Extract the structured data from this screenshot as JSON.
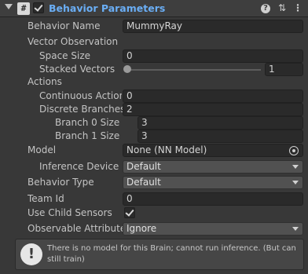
{
  "header": {
    "title": "Behavior Parameters",
    "script_glyph": "#",
    "help_glyph": "?",
    "preset_glyph": "⇅",
    "more_glyph": "⋮",
    "enabled": true
  },
  "fields": {
    "behavior_name": {
      "label": "Behavior Name",
      "value": "MummyRay"
    },
    "vector_observation": {
      "label": "Vector Observation"
    },
    "space_size": {
      "label": "Space Size",
      "value": "0"
    },
    "stacked_vectors": {
      "label": "Stacked Vectors",
      "value": "1",
      "slider_fraction": 0.0
    },
    "actions": {
      "label": "Actions"
    },
    "continuous_actions": {
      "label": "Continuous Actions",
      "value": "0"
    },
    "discrete_branches": {
      "label": "Discrete Branches",
      "value": "2"
    },
    "branch_0_size": {
      "label": "Branch 0 Size",
      "value": "3"
    },
    "branch_1_size": {
      "label": "Branch 1 Size",
      "value": "3"
    },
    "model": {
      "label": "Model",
      "value": "None (NN Model)"
    },
    "inference_device": {
      "label": "Inference Device",
      "value": "Default"
    },
    "behavior_type": {
      "label": "Behavior Type",
      "value": "Default"
    },
    "team_id": {
      "label": "Team Id",
      "value": "0"
    },
    "use_child_sensors": {
      "label": "Use Child Sensors",
      "checked": true
    },
    "observable_attribute": {
      "label": "Observable Attribute Handling",
      "value": "Ignore"
    }
  },
  "warning": {
    "icon": "!",
    "message": "There is no model for this Brain; cannot run inference. (But can still train)"
  },
  "colors": {
    "title": "#6aaef5",
    "panel_bg": "#383838",
    "field_bg": "#2a2a2a",
    "dropdown_bg": "#515151"
  }
}
